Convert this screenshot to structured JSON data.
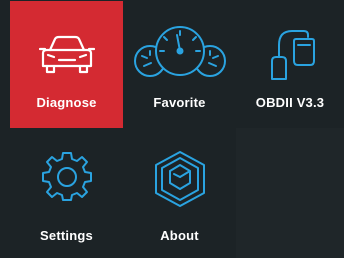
{
  "menu": {
    "tiles": [
      {
        "label": "Diagnose",
        "icon": "car-icon"
      },
      {
        "label": "Favorite",
        "icon": "gauges-icon"
      },
      {
        "label": "OBDII V3.3",
        "icon": "obd-connector-icon"
      },
      {
        "label": "Settings",
        "icon": "gear-icon"
      },
      {
        "label": "About",
        "icon": "cube-logo-icon"
      }
    ]
  },
  "colors": {
    "selected_tile": "#d42a32",
    "background": "#1c2326",
    "icon_accent": "#2aa3e0",
    "text": "#ffffff"
  }
}
